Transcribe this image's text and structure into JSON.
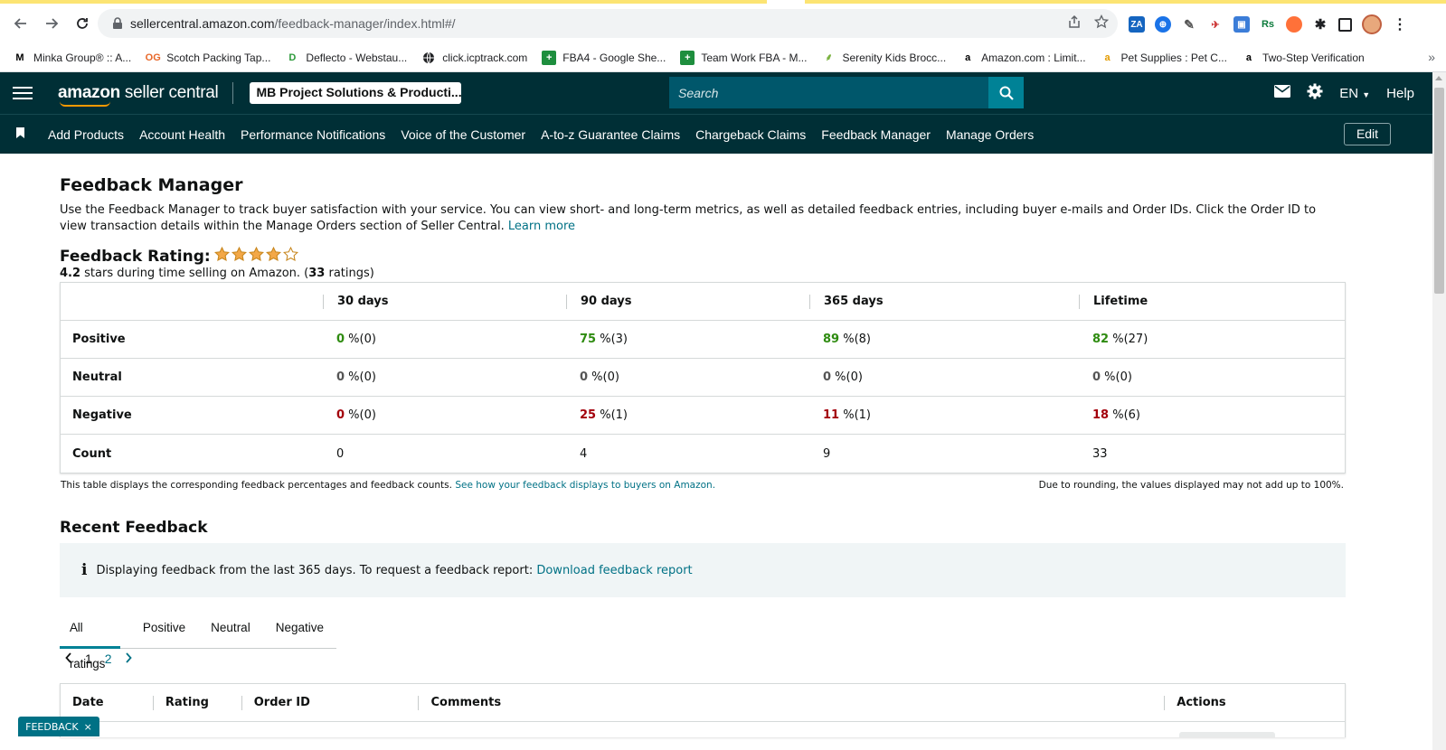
{
  "browser": {
    "url_host": "sellercentral.amazon.com",
    "url_path": "/feedback-manager/index.html#/",
    "bookmarks": [
      {
        "label": "Minka Group® :: A...",
        "icon": "M",
        "color": "#000000"
      },
      {
        "label": "Scotch Packing Tap...",
        "icon": "OG",
        "color": "#e8682a"
      },
      {
        "label": "Deflecto - Webstau...",
        "icon": "D",
        "color": "#2c9a3b"
      },
      {
        "label": "click.icptrack.com",
        "icon": "globe",
        "color": "#202124"
      },
      {
        "label": "FBA4 - Google She...",
        "icon": "+",
        "color": "#1e8e3e"
      },
      {
        "label": "Team Work FBA - M...",
        "icon": "+",
        "color": "#1e8e3e"
      },
      {
        "label": "Serenity Kids Brocc...",
        "icon": "leaf",
        "color": "#7cb342"
      },
      {
        "label": "Amazon.com : Limit...",
        "icon": "a",
        "color": "#000000"
      },
      {
        "label": "Pet Supplies : Pet C...",
        "icon": "a",
        "color": "#e39b00"
      },
      {
        "label": "Two-Step Verification",
        "icon": "a",
        "color": "#000000"
      }
    ],
    "more": "»"
  },
  "header": {
    "logo_bold": "amazon",
    "logo_light": " seller central",
    "store": "MB Project Solutions & Producti...",
    "search_placeholder": "Search",
    "language": "EN",
    "help": "Help"
  },
  "nav": {
    "links": [
      "Add Products",
      "Account Health",
      "Performance Notifications",
      "Voice of the Customer",
      "A-to-z Guarantee Claims",
      "Chargeback Claims",
      "Feedback Manager",
      "Manage Orders"
    ],
    "edit": "Edit"
  },
  "page": {
    "title": "Feedback Manager",
    "intro": "Use the Feedback Manager to track buyer satisfaction with your service. You can view short- and long-term metrics, as well as detailed feedback entries, including buyer e-mails and Order IDs. Click the Order ID to view transaction details within the Manage Orders section of Seller Central. ",
    "learn_more": "Learn more",
    "rating_label": "Feedback Rating:",
    "rating_stars": 4,
    "rating_max": 5,
    "rating_value": "4.2",
    "rating_text": " stars during time selling on Amazon. (",
    "rating_count": "33",
    "rating_suffix": " ratings)"
  },
  "metrics": {
    "headers": [
      "30 days",
      "90 days",
      "365 days",
      "Lifetime"
    ],
    "rows": [
      {
        "label": "Positive",
        "kind": "pos",
        "cells": [
          [
            "0",
            " %(0)"
          ],
          [
            "75",
            " %(3)"
          ],
          [
            "89",
            " %(8)"
          ],
          [
            "82",
            " %(27)"
          ]
        ]
      },
      {
        "label": "Neutral",
        "kind": "neu",
        "cells": [
          [
            "0",
            " %(0)"
          ],
          [
            "0",
            " %(0)"
          ],
          [
            "0",
            " %(0)"
          ],
          [
            "0",
            " %(0)"
          ]
        ]
      },
      {
        "label": "Negative",
        "kind": "neg",
        "cells": [
          [
            "0",
            " %(0)"
          ],
          [
            "25",
            " %(1)"
          ],
          [
            "11",
            " %(1)"
          ],
          [
            "18",
            " %(6)"
          ]
        ]
      }
    ],
    "count_label": "Count",
    "counts": [
      "0",
      "4",
      "9",
      "33"
    ],
    "note": "This table displays the corresponding feedback percentages and feedback counts. ",
    "note_link": "See how your feedback displays to buyers on Amazon.",
    "note_right": "Due to rounding, the values displayed may not add up to 100%."
  },
  "recent": {
    "title": "Recent Feedback",
    "info_icon": "i",
    "info_text": "Displaying feedback from the last 365 days. To request a feedback report: ",
    "info_link": "Download feedback report",
    "tabs": [
      "All ratings",
      "Positive",
      "Neutral",
      "Negative"
    ],
    "pages": [
      "1",
      "2"
    ],
    "columns": [
      "Date",
      "Rating",
      "Order ID",
      "Comments",
      "Actions"
    ]
  },
  "feedback_button": {
    "label": "FEEDBACK",
    "close": "×"
  },
  "colors": {
    "header_bg": "#002f36",
    "search_bg": "#00576b",
    "link": "#007185",
    "positive": "#2e8b10",
    "negative": "#a3000b",
    "star": "#f3a847"
  }
}
